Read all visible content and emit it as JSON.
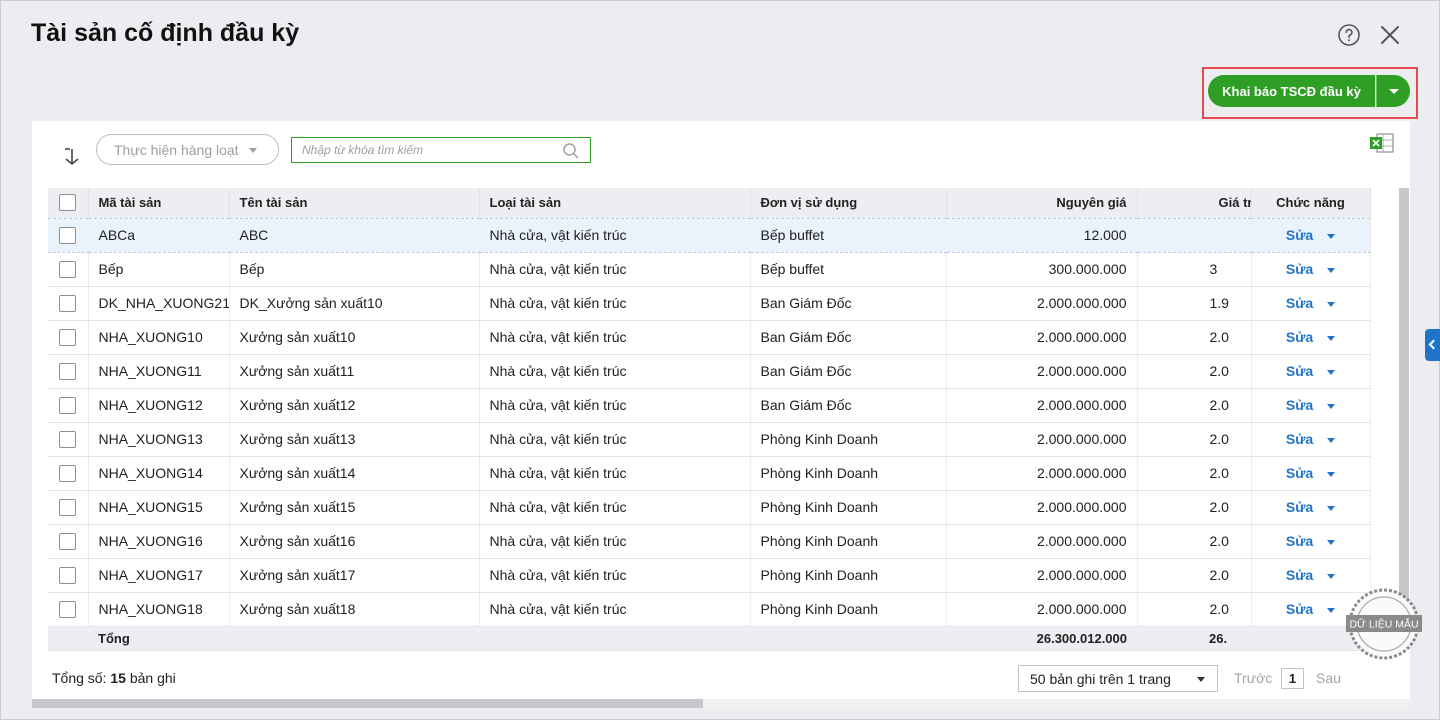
{
  "dialog": {
    "title": "Tài sản cố định đầu kỳ",
    "primary_button": "Khai báo TSCĐ đầu kỳ"
  },
  "toolbar": {
    "bulk_action": "Thực hiện hàng loạt",
    "search_placeholder": "Nhập từ khóa tìm kiếm"
  },
  "columns": [
    "Mã tài sản",
    "Tên tài sản",
    "Loại tài sản",
    "Đơn vị sử dụng",
    "Nguyên giá",
    "Giá trị",
    "Chức năng"
  ],
  "rows": [
    {
      "code": "ABCa",
      "name": "ABC",
      "type": "Nhà cửa, vật kiến trúc",
      "unit": "Bếp buffet",
      "cost": "12.000",
      "value": "",
      "action": "Sửa"
    },
    {
      "code": "Bếp",
      "name": "Bếp",
      "type": "Nhà cửa, vật kiến trúc",
      "unit": "Bếp buffet",
      "cost": "300.000.000",
      "value": "3",
      "action": "Sửa"
    },
    {
      "code": "DK_NHA_XUONG21",
      "name": "DK_Xưởng sản xuất10",
      "type": "Nhà cửa, vật kiến trúc",
      "unit": "Ban Giám Đốc",
      "cost": "2.000.000.000",
      "value": "1.9",
      "action": "Sửa"
    },
    {
      "code": "NHA_XUONG10",
      "name": "Xưởng sản xuất10",
      "type": "Nhà cửa, vật kiến trúc",
      "unit": "Ban Giám Đốc",
      "cost": "2.000.000.000",
      "value": "2.0",
      "action": "Sửa"
    },
    {
      "code": "NHA_XUONG11",
      "name": "Xưởng sản xuất11",
      "type": "Nhà cửa, vật kiến trúc",
      "unit": "Ban Giám Đốc",
      "cost": "2.000.000.000",
      "value": "2.0",
      "action": "Sửa"
    },
    {
      "code": "NHA_XUONG12",
      "name": "Xưởng sản xuất12",
      "type": "Nhà cửa, vật kiến trúc",
      "unit": "Ban Giám Đốc",
      "cost": "2.000.000.000",
      "value": "2.0",
      "action": "Sửa"
    },
    {
      "code": "NHA_XUONG13",
      "name": "Xưởng sản xuất13",
      "type": "Nhà cửa, vật kiến trúc",
      "unit": "Phòng Kinh Doanh",
      "cost": "2.000.000.000",
      "value": "2.0",
      "action": "Sửa"
    },
    {
      "code": "NHA_XUONG14",
      "name": "Xưởng sản xuất14",
      "type": "Nhà cửa, vật kiến trúc",
      "unit": "Phòng Kinh Doanh",
      "cost": "2.000.000.000",
      "value": "2.0",
      "action": "Sửa"
    },
    {
      "code": "NHA_XUONG15",
      "name": "Xưởng sản xuất15",
      "type": "Nhà cửa, vật kiến trúc",
      "unit": "Phòng Kinh Doanh",
      "cost": "2.000.000.000",
      "value": "2.0",
      "action": "Sửa"
    },
    {
      "code": "NHA_XUONG16",
      "name": "Xưởng sản xuất16",
      "type": "Nhà cửa, vật kiến trúc",
      "unit": "Phòng Kinh Doanh",
      "cost": "2.000.000.000",
      "value": "2.0",
      "action": "Sửa"
    },
    {
      "code": "NHA_XUONG17",
      "name": "Xưởng sản xuất17",
      "type": "Nhà cửa, vật kiến trúc",
      "unit": "Phòng Kinh Doanh",
      "cost": "2.000.000.000",
      "value": "2.0",
      "action": "Sửa"
    },
    {
      "code": "NHA_XUONG18",
      "name": "Xưởng sản xuất18",
      "type": "Nhà cửa, vật kiến trúc",
      "unit": "Phòng Kinh Doanh",
      "cost": "2.000.000.000",
      "value": "2.0",
      "action": "Sửa"
    }
  ],
  "totals": {
    "label": "Tổng",
    "cost": "26.300.012.000",
    "value": "26."
  },
  "footer": {
    "total_prefix": "Tổng số: ",
    "total_count": "15",
    "total_suffix": " bản ghi",
    "page_size": "50 bản ghi trên 1 trang",
    "prev": "Trước",
    "page": "1",
    "next": "Sau"
  },
  "stamp_text": "DỮ LIỆU MẪU",
  "colors": {
    "primary": "#2e9e24",
    "link": "#1f73c8",
    "highlight": "#e5484d"
  }
}
